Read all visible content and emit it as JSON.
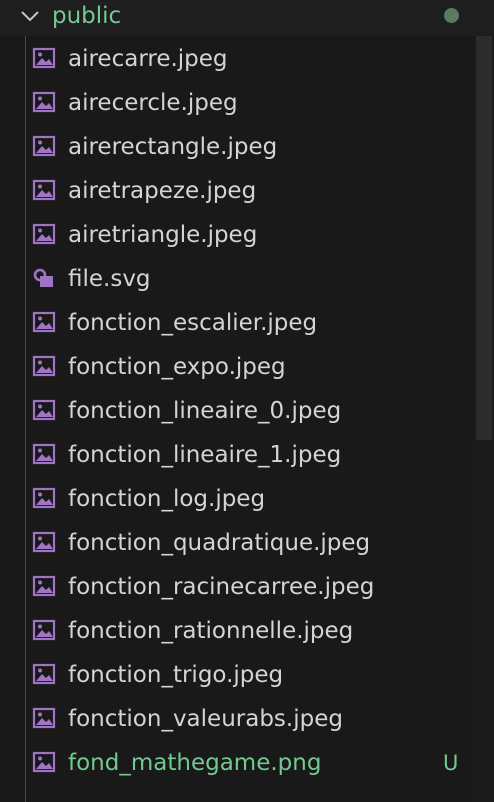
{
  "folder": {
    "name": "public",
    "chevron_icon": "chevron-down-icon",
    "status_dot_color": "#587c5f",
    "label_color": "#73c991"
  },
  "files": [
    {
      "name": "airecarre.jpeg",
      "icon": "image-file-icon",
      "status": ""
    },
    {
      "name": "airecercle.jpeg",
      "icon": "image-file-icon",
      "status": ""
    },
    {
      "name": "airerectangle.jpeg",
      "icon": "image-file-icon",
      "status": ""
    },
    {
      "name": "airetrapeze.jpeg",
      "icon": "image-file-icon",
      "status": ""
    },
    {
      "name": "airetriangle.jpeg",
      "icon": "image-file-icon",
      "status": ""
    },
    {
      "name": "file.svg",
      "icon": "svg-file-icon",
      "status": ""
    },
    {
      "name": "fonction_escalier.jpeg",
      "icon": "image-file-icon",
      "status": ""
    },
    {
      "name": "fonction_expo.jpeg",
      "icon": "image-file-icon",
      "status": ""
    },
    {
      "name": "fonction_lineaire_0.jpeg",
      "icon": "image-file-icon",
      "status": ""
    },
    {
      "name": "fonction_lineaire_1.jpeg",
      "icon": "image-file-icon",
      "status": ""
    },
    {
      "name": "fonction_log.jpeg",
      "icon": "image-file-icon",
      "status": ""
    },
    {
      "name": "fonction_quadratique.jpeg",
      "icon": "image-file-icon",
      "status": ""
    },
    {
      "name": "fonction_racinecarree.jpeg",
      "icon": "image-file-icon",
      "status": ""
    },
    {
      "name": "fonction_rationnelle.jpeg",
      "icon": "image-file-icon",
      "status": ""
    },
    {
      "name": "fonction_trigo.jpeg",
      "icon": "image-file-icon",
      "status": ""
    },
    {
      "name": "fonction_valeurabs.jpeg",
      "icon": "image-file-icon",
      "status": ""
    },
    {
      "name": "fond_mathegame.png",
      "icon": "image-file-icon",
      "status": "U"
    }
  ],
  "colors": {
    "icon_purple": "#a074c4",
    "untracked_green": "#73c991",
    "text": "#d4d4d4"
  }
}
